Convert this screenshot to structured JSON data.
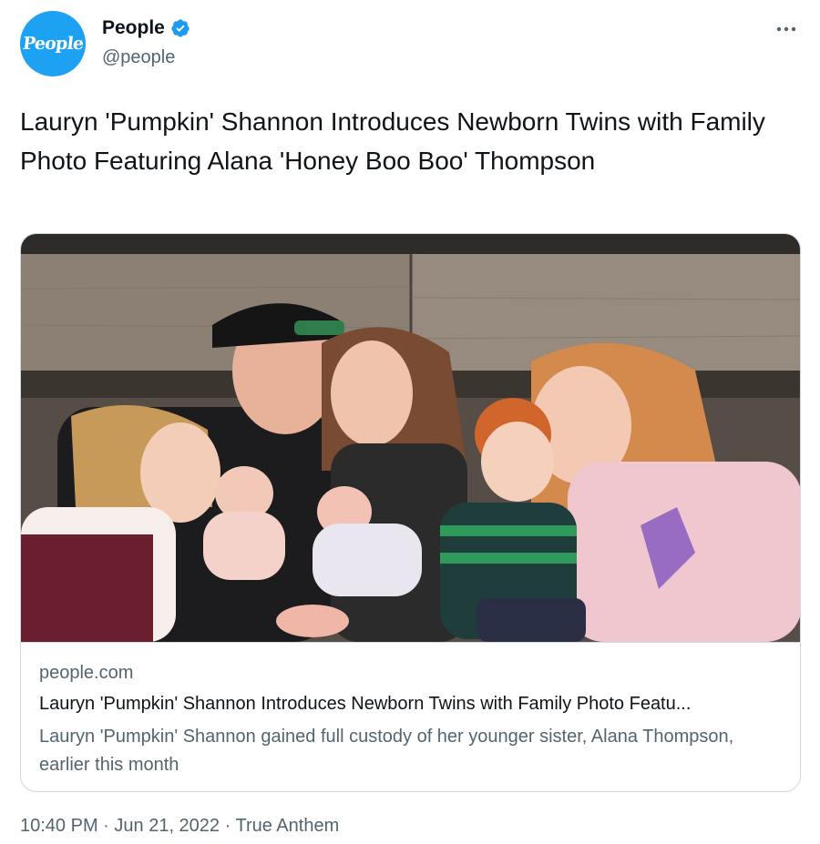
{
  "author": {
    "display_name": "People",
    "handle": "@people",
    "avatar_text": "People",
    "verified": true,
    "avatar_color": "#1da1f2",
    "verified_color": "#1d9bf0"
  },
  "tweet": {
    "text": "Lauryn 'Pumpkin' Shannon Introduces Newborn Twins with Family Photo Featuring Alana 'Honey Boo Boo' Thompson"
  },
  "card": {
    "domain": "people.com",
    "title": "Lauryn 'Pumpkin' Shannon Introduces Newborn Twins with Family Photo Featu...",
    "description": "Lauryn 'Pumpkin' Shannon gained full custody of her younger sister, Alana Thompson, earlier this month",
    "image_icon": "family-photo"
  },
  "meta": {
    "time": "10:40 PM",
    "separator": " · ",
    "date": "Jun 21, 2022",
    "source": "True Anthem"
  },
  "icons": {
    "more": "more-icon",
    "verified": "verified-badge-icon"
  }
}
